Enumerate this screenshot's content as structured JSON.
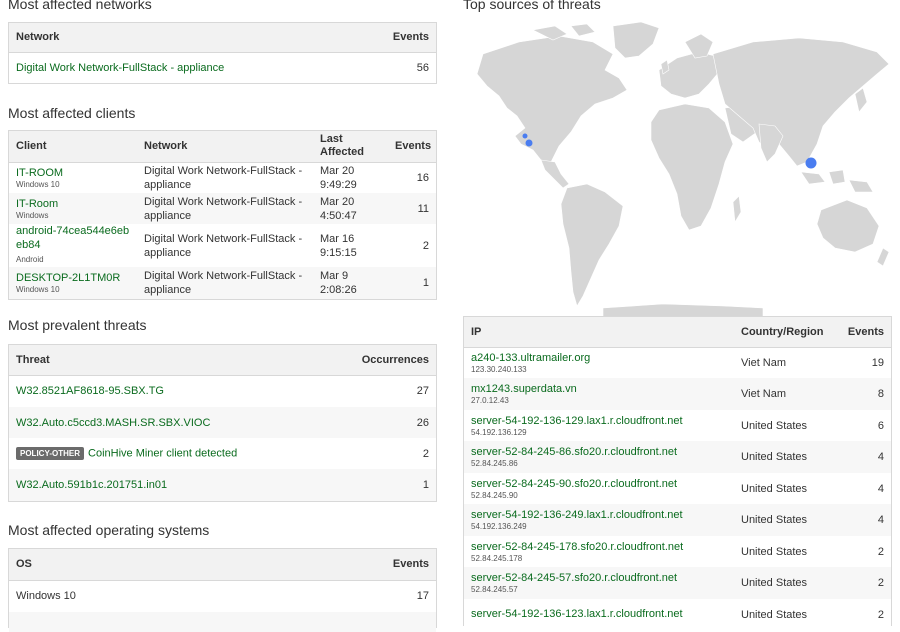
{
  "networks": {
    "title": "Most affected networks",
    "columns": [
      "Network",
      "Events"
    ],
    "rows": [
      {
        "network": "Digital Work Network-FullStack - appliance",
        "events": "56"
      }
    ]
  },
  "clients": {
    "title": "Most affected clients",
    "columns": [
      "Client",
      "Network",
      "Last Affected",
      "Events"
    ],
    "rows": [
      {
        "client": "IT-ROOM",
        "os": "Windows 10",
        "network": "Digital Work Network-FullStack - appliance",
        "date": "Mar 20",
        "time": "9:49:29",
        "events": "16"
      },
      {
        "client": "IT-Room",
        "os": "Windows",
        "network": "Digital Work Network-FullStack - appliance",
        "date": "Mar 20",
        "time": "4:50:47",
        "events": "11"
      },
      {
        "client": "android-74cea544e6ebeb84",
        "os": "Android",
        "network": "Digital Work Network-FullStack - appliance",
        "date": "Mar 16",
        "time": "9:15:15",
        "events": "2"
      },
      {
        "client": "DESKTOP-2L1TM0R",
        "os": "Windows 10",
        "network": "Digital Work Network-FullStack - appliance",
        "date": "Mar 9",
        "time": "2:08:26",
        "events": "1"
      }
    ]
  },
  "threats": {
    "title": "Most prevalent threats",
    "columns": [
      "Threat",
      "Occurrences"
    ],
    "rows": [
      {
        "badge": "",
        "threat": "W32.8521AF8618-95.SBX.TG",
        "count": "27"
      },
      {
        "badge": "",
        "threat": "W32.Auto.c5ccd3.MASH.SR.SBX.VIOC",
        "count": "26"
      },
      {
        "badge": "POLICY-OTHER",
        "threat": "CoinHive Miner client detected",
        "count": "2"
      },
      {
        "badge": "",
        "threat": "W32.Auto.591b1c.201751.in01",
        "count": "1"
      }
    ]
  },
  "os": {
    "title": "Most affected operating systems",
    "columns": [
      "OS",
      "Events"
    ],
    "rows": [
      {
        "os": "Windows 10",
        "events": "17"
      }
    ]
  },
  "sources": {
    "title": "Top sources of threats",
    "columns": [
      "IP",
      "Country/Region",
      "Events"
    ],
    "rows": [
      {
        "host": "a240-133.ultramailer.org",
        "ip": "123.30.240.133",
        "country": "Viet Nam",
        "events": "19"
      },
      {
        "host": "mx1243.superdata.vn",
        "ip": "27.0.12.43",
        "country": "Viet Nam",
        "events": "8"
      },
      {
        "host": "server-54-192-136-129.lax1.r.cloudfront.net",
        "ip": "54.192.136.129",
        "country": "United States",
        "events": "6"
      },
      {
        "host": "server-52-84-245-86.sfo20.r.cloudfront.net",
        "ip": "52.84.245.86",
        "country": "United States",
        "events": "4"
      },
      {
        "host": "server-52-84-245-90.sfo20.r.cloudfront.net",
        "ip": "52.84.245.90",
        "country": "United States",
        "events": "4"
      },
      {
        "host": "server-54-192-136-249.lax1.r.cloudfront.net",
        "ip": "54.192.136.249",
        "country": "United States",
        "events": "4"
      },
      {
        "host": "server-52-84-245-178.sfo20.r.cloudfront.net",
        "ip": "52.84.245.178",
        "country": "United States",
        "events": "2"
      },
      {
        "host": "server-52-84-245-57.sfo20.r.cloudfront.net",
        "ip": "52.84.245.57",
        "country": "United States",
        "events": "2"
      },
      {
        "host": "server-54-192-136-123.lax1.r.cloudfront.net",
        "ip": "",
        "country": "United States",
        "events": "2"
      }
    ]
  },
  "colors": {
    "link": "#0a6b1e",
    "land": "#d6d6d6",
    "marker": "#4a7df0",
    "header_bg": "#f2f2f2",
    "badge": "#6b6b6b"
  }
}
